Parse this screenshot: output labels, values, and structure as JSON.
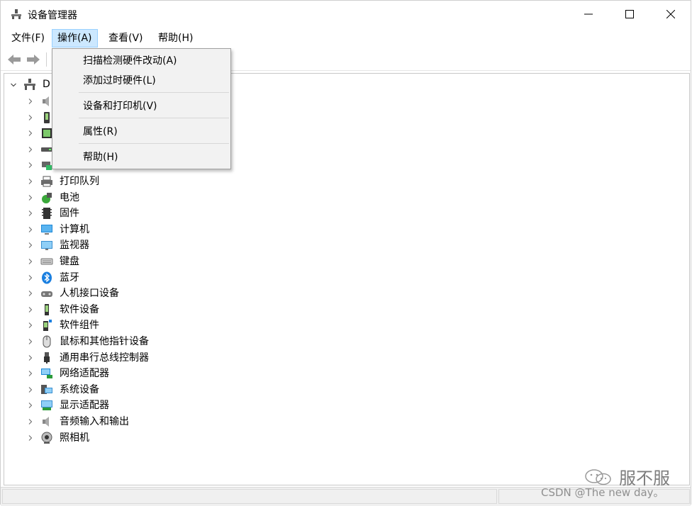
{
  "window": {
    "title": "设备管理器"
  },
  "menubar": {
    "items": [
      {
        "label": "文件(F)"
      },
      {
        "label": "操作(A)"
      },
      {
        "label": "查看(V)"
      },
      {
        "label": "帮助(H)"
      }
    ]
  },
  "action_menu": {
    "items": [
      {
        "label": "扫描检测硬件改动(A)"
      },
      {
        "label": "添加过时硬件(L)"
      },
      {
        "label": "设备和打印机(V)"
      },
      {
        "label": "属性(R)"
      },
      {
        "label": "帮助(H)"
      }
    ]
  },
  "tree": {
    "root_label": "D",
    "nodes": [
      {
        "label": "",
        "icon": "speaker-icon"
      },
      {
        "label": "",
        "icon": "phone-device-icon"
      },
      {
        "label": "",
        "icon": "chip-icon"
      },
      {
        "label": "",
        "icon": "disk-drive-icon"
      },
      {
        "label": "",
        "icon": "storage-controller-icon"
      },
      {
        "label": "打印队列",
        "icon": "printer-icon"
      },
      {
        "label": "电池",
        "icon": "battery-icon"
      },
      {
        "label": "固件",
        "icon": "firmware-icon"
      },
      {
        "label": "计算机",
        "icon": "computer-icon"
      },
      {
        "label": "监视器",
        "icon": "monitor-icon"
      },
      {
        "label": "键盘",
        "icon": "keyboard-icon"
      },
      {
        "label": "蓝牙",
        "icon": "bluetooth-icon"
      },
      {
        "label": "人机接口设备",
        "icon": "hid-icon"
      },
      {
        "label": "软件设备",
        "icon": "software-device-icon"
      },
      {
        "label": "软件组件",
        "icon": "software-component-icon"
      },
      {
        "label": "鼠标和其他指针设备",
        "icon": "mouse-icon"
      },
      {
        "label": "通用串行总线控制器",
        "icon": "usb-icon"
      },
      {
        "label": "网络适配器",
        "icon": "network-adapter-icon"
      },
      {
        "label": "系统设备",
        "icon": "system-device-icon"
      },
      {
        "label": "显示适配器",
        "icon": "display-adapter-icon"
      },
      {
        "label": "音频输入和输出",
        "icon": "audio-io-icon"
      },
      {
        "label": "照相机",
        "icon": "camera-icon"
      }
    ]
  },
  "watermark": {
    "brand": "服不服",
    "credit": "CSDN @The  new  day。"
  }
}
